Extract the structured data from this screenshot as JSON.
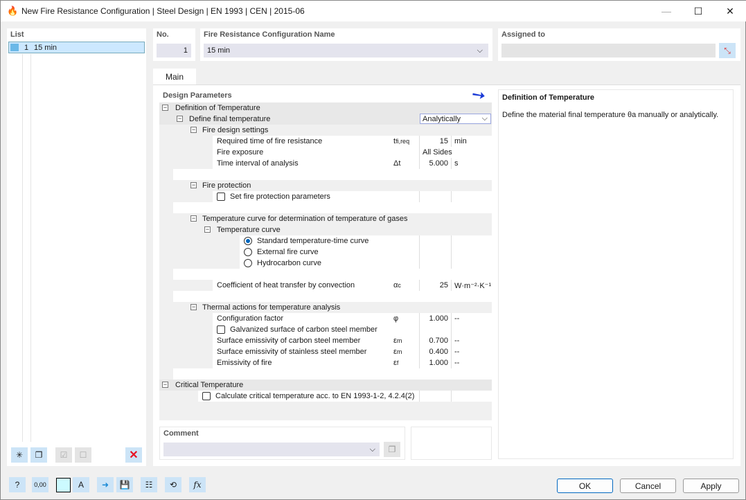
{
  "window": {
    "title": "New Fire Resistance Configuration | Steel Design | EN 1993 | CEN | 2015-06",
    "minimize": "—",
    "maximize": "☐",
    "close": "✕"
  },
  "list": {
    "label": "List",
    "items": [
      {
        "no": "1",
        "name": "15 min"
      }
    ]
  },
  "no": {
    "label": "No.",
    "value": "1"
  },
  "name": {
    "label": "Fire Resistance Configuration Name",
    "value": "15 min"
  },
  "assigned": {
    "label": "Assigned to",
    "value": ""
  },
  "tab": "Main",
  "design_parameters": {
    "label": "Design Parameters",
    "rows": [
      {
        "level": 0,
        "type": "group",
        "label": "Definition of Temperature"
      },
      {
        "level": 1,
        "type": "group",
        "label": "Define final temperature",
        "value": "Analytically",
        "dropdown": true
      },
      {
        "level": 2,
        "type": "group",
        "label": "Fire design settings"
      },
      {
        "level": 3,
        "type": "item",
        "label": "Required time of fire resistance",
        "symbol": "t",
        "sub": "fi,req",
        "value": "15",
        "unit": "min"
      },
      {
        "level": 3,
        "type": "item",
        "label": "Fire exposure",
        "value": "All Sides"
      },
      {
        "level": 3,
        "type": "item",
        "label": "Time interval of analysis",
        "symbol": "Δt",
        "value": "5.000",
        "unit": "s"
      },
      {
        "type": "blank"
      },
      {
        "level": 2,
        "type": "group",
        "label": "Fire protection"
      },
      {
        "level": 3,
        "type": "checkbox",
        "label": "Set fire protection parameters",
        "checked": false
      },
      {
        "type": "blank"
      },
      {
        "level": 2,
        "type": "group",
        "label": "Temperature curve for determination of temperature of gases"
      },
      {
        "level": 3,
        "type": "group",
        "label": "Temperature curve"
      },
      {
        "level": 4,
        "type": "radio",
        "label": "Standard temperature-time curve",
        "checked": true
      },
      {
        "level": 4,
        "type": "radio",
        "label": "External fire curve",
        "checked": false
      },
      {
        "level": 4,
        "type": "radio",
        "label": "Hydrocarbon curve",
        "checked": false
      },
      {
        "type": "blank"
      },
      {
        "level": 3,
        "type": "item",
        "label": "Coefficient of heat transfer by convection",
        "symbol": "α",
        "sub": "c",
        "value": "25",
        "unit": "W·m⁻²·K⁻¹"
      },
      {
        "type": "blank"
      },
      {
        "level": 2,
        "type": "group",
        "label": "Thermal actions for temperature analysis"
      },
      {
        "level": 3,
        "type": "item",
        "label": "Configuration factor",
        "symbol": "φ",
        "value": "1.000",
        "unit": "--"
      },
      {
        "level": 3,
        "type": "checkbox",
        "label": "Galvanized surface of carbon steel member",
        "checked": false
      },
      {
        "level": 3,
        "type": "item",
        "label": "Surface emissivity of carbon steel member",
        "symbol": "ε",
        "sub": "m",
        "value": "0.700",
        "unit": "--"
      },
      {
        "level": 3,
        "type": "item",
        "label": "Surface emissivity of stainless steel member",
        "symbol": "ε",
        "sub": "m",
        "value": "0.400",
        "unit": "--"
      },
      {
        "level": 3,
        "type": "item",
        "label": "Emissivity of fire",
        "symbol": "ε",
        "sub": "f",
        "value": "1.000",
        "unit": "--"
      },
      {
        "type": "blank"
      },
      {
        "level": 0,
        "type": "group",
        "label": "Critical Temperature"
      },
      {
        "level": 2,
        "type": "checkbox",
        "label": "Calculate critical temperature acc. to EN 1993-1-2, 4.2.4(2)",
        "checked": false
      }
    ]
  },
  "info": {
    "title": "Definition of Temperature",
    "text": "Define the material final temperature θa manually or analytically."
  },
  "comment": {
    "label": "Comment",
    "value": ""
  },
  "buttons": {
    "ok": "OK",
    "cancel": "Cancel",
    "apply": "Apply"
  },
  "bottom_icons": [
    "help-icon",
    "units-icon",
    "color-icon",
    "text-style-icon",
    "export-icon",
    "save-icon",
    "library-icon",
    "reset-icon",
    "formula-icon"
  ],
  "list_icons": [
    "new-icon",
    "copy-icon",
    "check-all-icon",
    "toggle-check-icon",
    "delete-icon"
  ],
  "colors": {
    "accent": "#0067c0",
    "selection": "#cce8ff",
    "arrow": "#1a3ad6",
    "delete": "#e81123"
  }
}
